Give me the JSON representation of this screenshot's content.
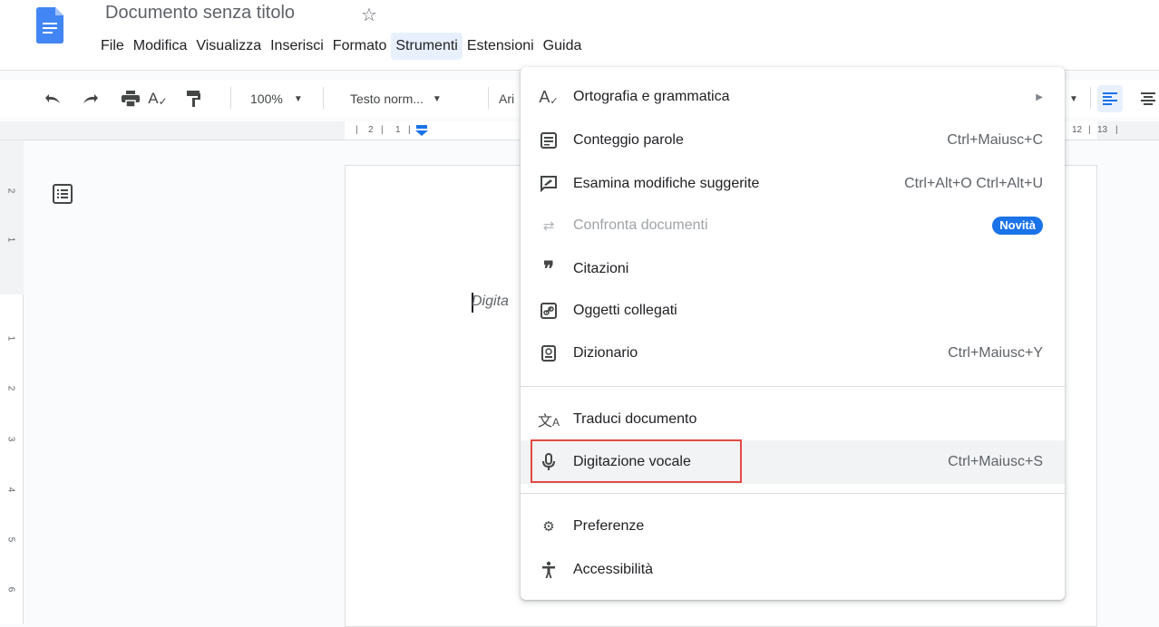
{
  "header": {
    "title": "Documento senza titolo",
    "star_icon": "star-outline-icon"
  },
  "menubar": {
    "items": [
      "File",
      "Modifica",
      "Visualizza",
      "Inserisci",
      "Formato",
      "Strumenti",
      "Estensioni",
      "Guida"
    ],
    "active": "Strumenti"
  },
  "toolbar": {
    "zoom": "100%",
    "style": "Testo norm...",
    "font": "Ari"
  },
  "ruler": {
    "left_numbers": [
      "2",
      "1"
    ],
    "right_numbers": [
      "12",
      "13"
    ]
  },
  "vruler": {
    "numbers": [
      "2",
      "1",
      "1",
      "2",
      "3",
      "4",
      "5",
      "6"
    ]
  },
  "page": {
    "placeholder": "Digita"
  },
  "dropdown": {
    "items": [
      {
        "label": "Ortografia e grammatica",
        "icon": "spellcheck-icon",
        "submenu": true
      },
      {
        "label": "Conteggio parole",
        "icon": "word-count-icon",
        "shortcut": "Ctrl+Maiusc+C"
      },
      {
        "label": "Esamina modifiche suggerite",
        "icon": "review-edits-icon",
        "shortcut": "Ctrl+Alt+O Ctrl+Alt+U"
      },
      {
        "label": "Confronta documenti",
        "icon": "compare-icon",
        "badge": "Novità",
        "disabled": true
      },
      {
        "label": "Citazioni",
        "icon": "quote-icon"
      },
      {
        "label": "Oggetti collegati",
        "icon": "link-objects-icon"
      },
      {
        "label": "Dizionario",
        "icon": "dictionary-icon",
        "shortcut": "Ctrl+Maiusc+Y"
      },
      {
        "label": "Traduci documento",
        "icon": "translate-icon"
      },
      {
        "label": "Digitazione vocale",
        "icon": "microphone-icon",
        "shortcut": "Ctrl+Maiusc+S",
        "highlighted": true
      },
      {
        "label": "Preferenze",
        "icon": "preferences-icon"
      },
      {
        "label": "Accessibilità",
        "icon": "accessibility-icon"
      }
    ]
  },
  "colors": {
    "accent": "#1a73e8",
    "highlight_border": "#e24a45",
    "menu_active_bg": "#e8f0fe"
  }
}
